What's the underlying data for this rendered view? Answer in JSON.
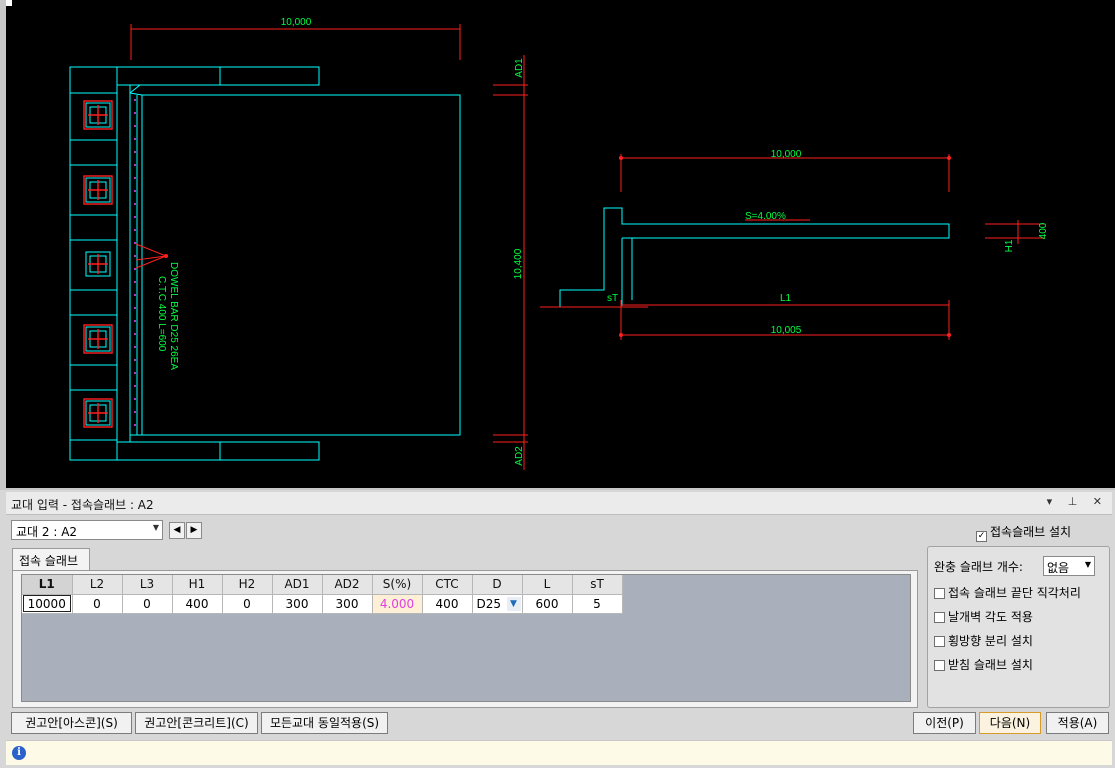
{
  "drawing": {
    "plan": {
      "top_dim": "10,000",
      "right_dim": "10,400",
      "ad1": "AD1",
      "ad2": "AD2",
      "dowel_line1": "DOWEL BAR D25 26EA",
      "dowel_line2": "C.T.C 400 L=600"
    },
    "section": {
      "top_dim": "10,000",
      "slope": "S=4.00%",
      "h_label": "H1",
      "h_value": "400",
      "st_label": "sT",
      "l_label": "L1",
      "bottom_dim": "10,005"
    },
    "colors": {
      "cyan": "#00ffff",
      "red": "#ff2020",
      "green": "#00ff40",
      "white": "#ffffff"
    }
  },
  "panel": {
    "title": "교대 입력 - 접속슬래브 : A2",
    "title_icons": "▾ ⊥ ✕",
    "abutment_select": "교대 2 : A2",
    "install_checkbox": {
      "label": "접속슬래브 설치",
      "checked": true
    },
    "tab": "접속 슬래브",
    "table": {
      "headers": [
        "L1",
        "L2",
        "L3",
        "H1",
        "H2",
        "AD1",
        "AD2",
        "S(%)",
        "CTC",
        "D",
        "L",
        "sT"
      ],
      "row": [
        "10000",
        "0",
        "0",
        "400",
        "0",
        "300",
        "300",
        "4.000",
        "400",
        "D25",
        "600",
        "5"
      ]
    },
    "options": {
      "buffer_label": "완충 슬래브 개수:",
      "buffer_value": "없음",
      "items": [
        {
          "label": "접속 슬래브 끝단 직각처리",
          "checked": false
        },
        {
          "label": "날개벽 각도 적용",
          "checked": false
        },
        {
          "label": "횡방향 분리 설치",
          "checked": false
        },
        {
          "label": "받침 슬래브 설치",
          "checked": false
        }
      ]
    },
    "buttons": {
      "ascon": "권고안[아스콘](S)",
      "concrete": "권고안[콘크리트](C)",
      "apply_all": "모든교대 동일적용(S)",
      "prev": "이전(P)",
      "next": "다음(N)",
      "apply": "적용(A)"
    },
    "status_icon": "info-icon"
  }
}
